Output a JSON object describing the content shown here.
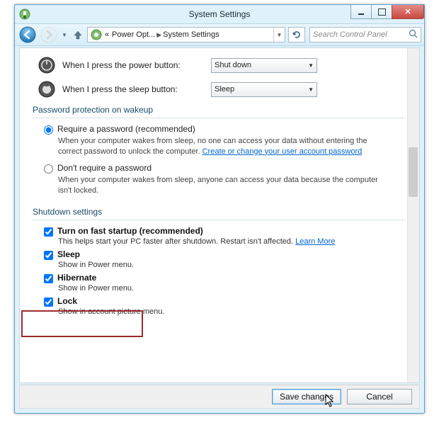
{
  "window": {
    "title": "System Settings"
  },
  "nav": {
    "breadcrumb": {
      "root_marker": "«",
      "level1": "Power Opt...",
      "level2": "System Settings"
    },
    "search_placeholder": "Search Control Panel"
  },
  "buttons": {
    "power": {
      "label": "When I press the power button:",
      "value": "Shut down"
    },
    "sleep": {
      "label": "When I press the sleep button:",
      "value": "Sleep"
    }
  },
  "password_section": {
    "title": "Password protection on wakeup",
    "require": {
      "label": "Require a password (recommended)",
      "desc_a": "When your computer wakes from sleep, no one can access your data without entering the correct password to unlock the computer. ",
      "link": "Create or change your user account password"
    },
    "dont_require": {
      "label": "Don't require a password",
      "desc": "When your computer wakes from sleep, anyone can access your data because the computer isn't locked."
    }
  },
  "shutdown_section": {
    "title": "Shutdown settings",
    "fast_startup": {
      "label": "Turn on fast startup (recommended)",
      "desc_a": "This helps start your PC faster after shutdown. Restart isn't affected. ",
      "link": "Learn More"
    },
    "sleep": {
      "label": "Sleep",
      "desc": "Show in Power menu."
    },
    "hibernate": {
      "label": "Hibernate",
      "desc": "Show in Power menu."
    },
    "lock": {
      "label": "Lock",
      "desc": "Show in account picture menu."
    }
  },
  "footer": {
    "save": "Save changes",
    "cancel": "Cancel"
  }
}
